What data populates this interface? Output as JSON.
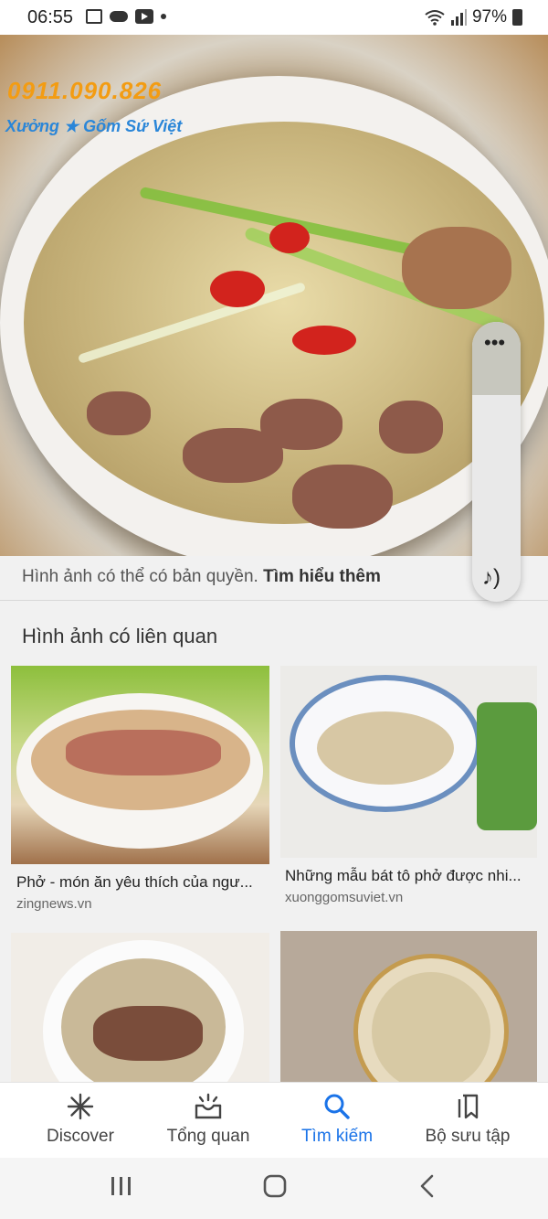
{
  "status_bar": {
    "time": "06:55",
    "battery": "97%"
  },
  "hero": {
    "watermark_phone": "0911.090.826",
    "watermark_brand": "Xưởng ★ Gốm Sứ Việt"
  },
  "caption": {
    "text": "Hình ảnh có thể có bản quyền. ",
    "link": "Tìm hiểu thêm"
  },
  "related": {
    "title": "Hình ảnh có liên quan",
    "cards": [
      {
        "title": "Phở - món ăn yêu thích của ngư...",
        "source": "zingnews.vn"
      },
      {
        "title": "Những mẫu bát tô phở được nhi...",
        "source": "xuonggomsuviet.vn"
      }
    ]
  },
  "bottom_nav": [
    {
      "label": "Discover",
      "icon": "asterisk-icon"
    },
    {
      "label": "Tổng quan",
      "icon": "inbox-icon"
    },
    {
      "label": "Tìm kiếm",
      "icon": "search-icon",
      "active": true
    },
    {
      "label": "Bộ sưu tập",
      "icon": "bookmark-collection-icon"
    }
  ],
  "colors": {
    "accent": "#1a73e8"
  }
}
